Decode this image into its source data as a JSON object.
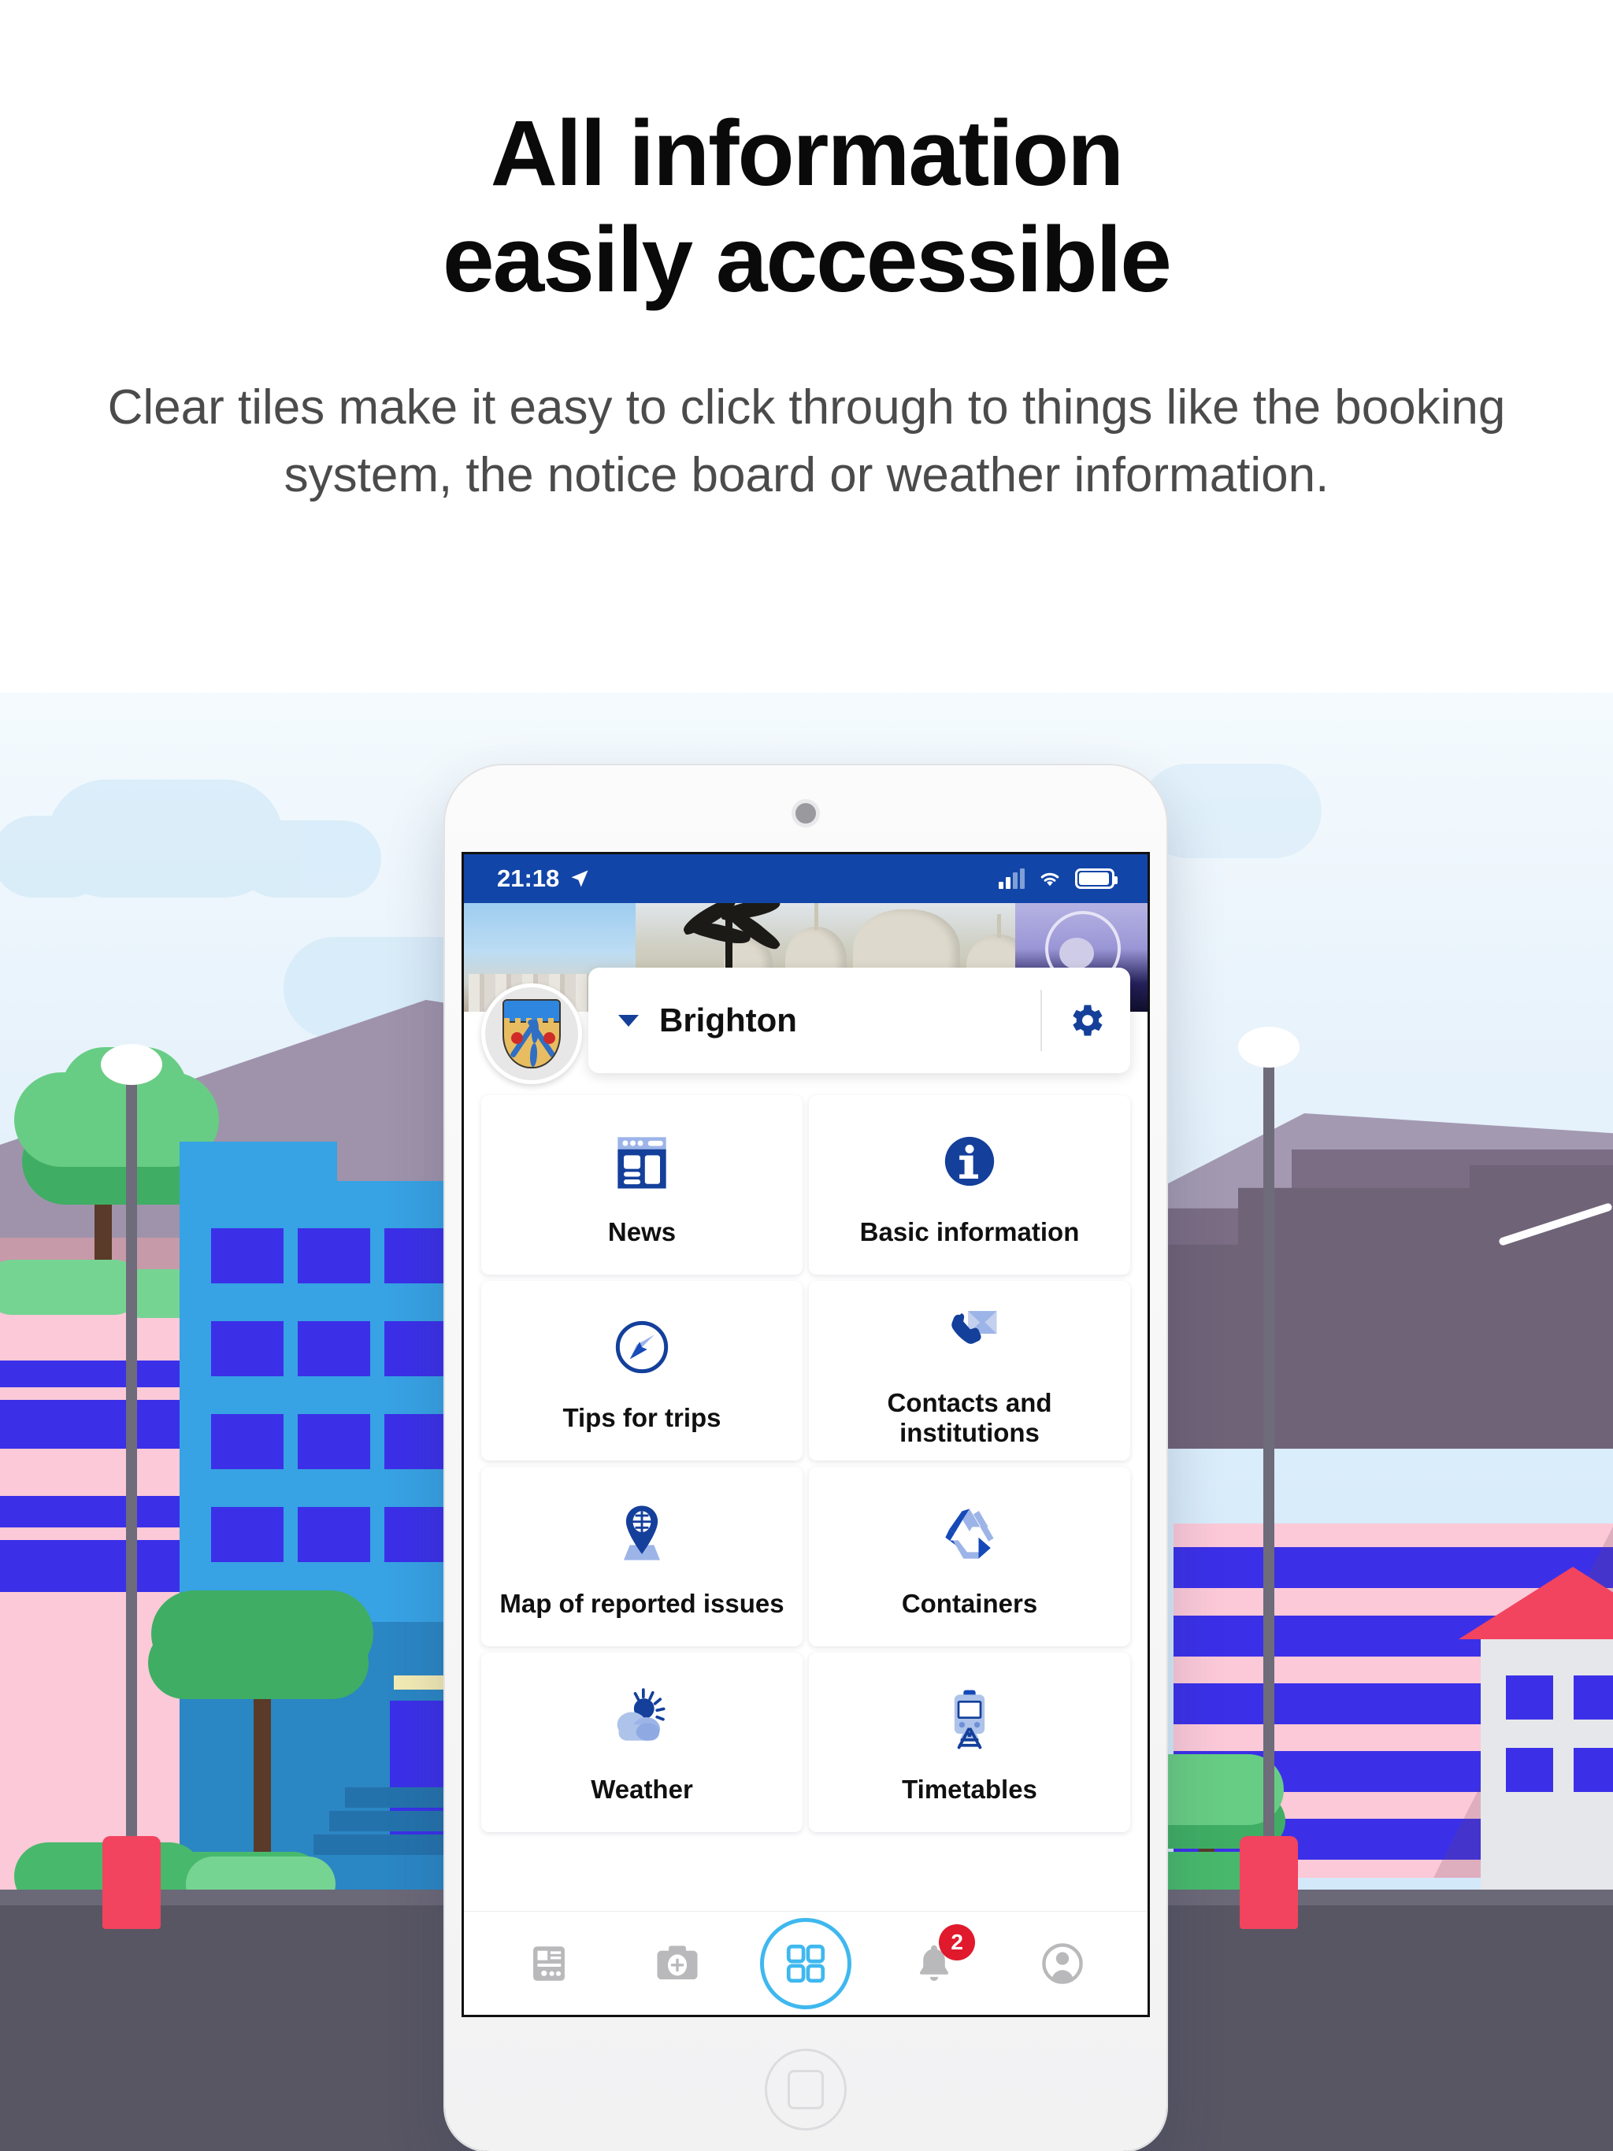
{
  "promo": {
    "headline_line1": "All information",
    "headline_line2": "easily accessible",
    "subhead": "Clear tiles make it easy to click through to things like the booking system, the notice board or weather information."
  },
  "phone": {
    "status_bar": {
      "time": "21:18",
      "location_icon": "location-arrow-icon",
      "signal_icon": "signal-bars-icon",
      "wifi_icon": "wifi-icon",
      "battery_icon": "battery-icon",
      "background_color": "#1245a8"
    },
    "banner": {
      "name": "brighton-photo-banner",
      "segments": [
        "brighton-seafront-photo",
        "royal-pavilion-photo",
        "brighton-pier-photo"
      ]
    },
    "selector": {
      "crest_icon": "brighton-coat-of-arms-icon",
      "chevron_icon": "chevron-down-icon",
      "city": "Brighton",
      "settings_icon": "gear-icon",
      "accent_color": "#15409a"
    },
    "tiles": [
      {
        "label": "News",
        "icon": "news-window-icon"
      },
      {
        "label": "Basic information",
        "icon": "info-circle-icon"
      },
      {
        "label": "Tips for trips",
        "icon": "compass-icon"
      },
      {
        "label": "Contacts and institutions",
        "icon": "phone-envelope-icon"
      },
      {
        "label": "Map of reported issues",
        "icon": "map-pin-globe-icon"
      },
      {
        "label": "Containers",
        "icon": "recycling-icon"
      },
      {
        "label": "Weather",
        "icon": "sun-cloud-icon"
      },
      {
        "label": "Timetables",
        "icon": "train-icon"
      }
    ],
    "nav": [
      {
        "name": "feed",
        "icon": "news-feed-icon",
        "active": false,
        "badge": ""
      },
      {
        "name": "report",
        "icon": "camera-add-icon",
        "active": false,
        "badge": ""
      },
      {
        "name": "dashboard",
        "icon": "grid-tiles-icon",
        "active": true,
        "badge": ""
      },
      {
        "name": "notifications",
        "icon": "bell-icon",
        "active": false,
        "badge": "2"
      },
      {
        "name": "profile",
        "icon": "user-avatar-icon",
        "active": false,
        "badge": ""
      }
    ],
    "nav_active_color": "#3fb8ef",
    "nav_badge_color": "#e0192c",
    "home_button_icon": "home-button-icon",
    "camera_icon": "front-camera-icon"
  },
  "illustration": {
    "name": "flat-city-illustration",
    "sun_icon": "sun-icon",
    "colors": {
      "sky_top": "#f5fbfe",
      "sky_bottom": "#cfe6f8",
      "sun": "#fbee9e",
      "road": "#585663",
      "building_pink": "#fbc9d8",
      "building_blue": "#37a2e4",
      "window_blue": "#3b30e8",
      "tree_green": "#68cd84",
      "lamp_base_red": "#f2435f",
      "hill_purple": "#9f93ab"
    }
  }
}
